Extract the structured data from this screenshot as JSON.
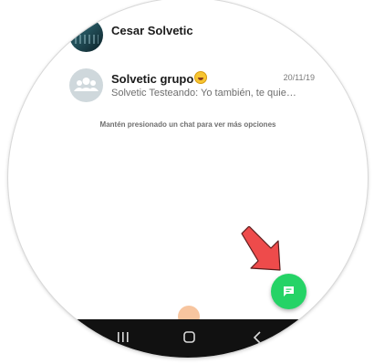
{
  "chats": [
    {
      "name": "Cesar Solvetic",
      "avatar_icon": "profile-photo",
      "date": "",
      "preview": ""
    },
    {
      "name": "Solvetic grupo",
      "emoji_icon": "grinning-face-icon",
      "avatar_icon": "group-icon",
      "date": "20/11/19",
      "preview": "Solvetic Testeando: Yo también, te quie…"
    }
  ],
  "hint": "Mantén presionado un chat para ver más opciones",
  "fab": {
    "icon": "new-chat-icon",
    "color": "#25d366"
  },
  "annotation": {
    "icon": "red-arrow-icon",
    "color": "#ee4b4b"
  },
  "navbar": {
    "buttons": [
      "recents-icon",
      "home-icon",
      "back-icon"
    ],
    "background": "#111111"
  }
}
